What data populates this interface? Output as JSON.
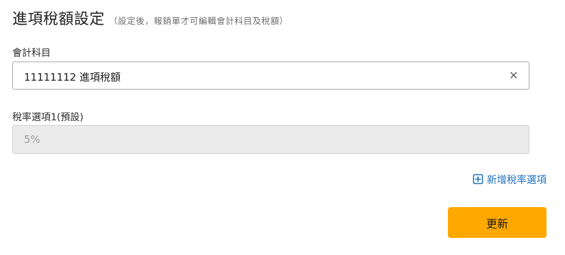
{
  "header": {
    "title": "進項稅額設定",
    "subtitle": "（設定後，報銷單才可編輯會計科目及稅額）"
  },
  "account_field": {
    "label": "會計科目",
    "value": "11111112 進項稅額",
    "clear_icon": "close-icon"
  },
  "rate_field": {
    "label": "稅率選項1(預設)",
    "value": "5%"
  },
  "add_option": {
    "label": "新增稅率選項",
    "icon": "plus-square-icon"
  },
  "submit": {
    "label": "更新"
  },
  "colors": {
    "accent_button": "#ffa800",
    "link": "#1f6fbf",
    "disabled_bg": "#ebebeb"
  }
}
